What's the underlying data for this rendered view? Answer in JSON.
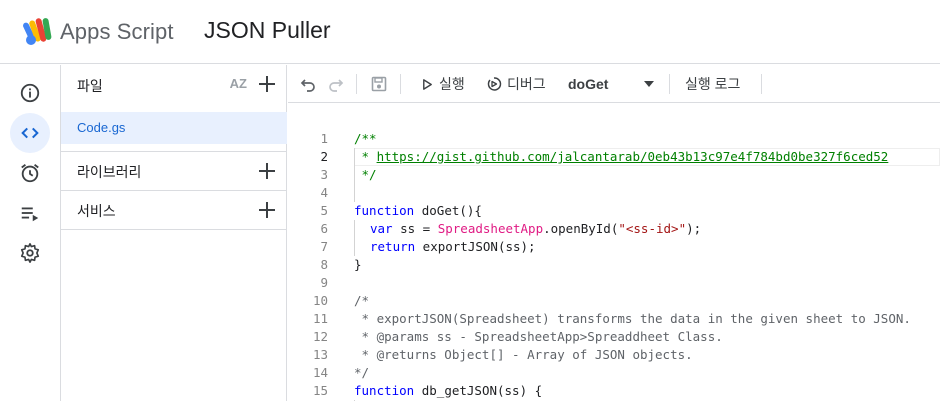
{
  "header": {
    "app_name": "Apps Script",
    "project_title": "JSON Puller"
  },
  "rail": {
    "items": [
      {
        "name": "overview",
        "icon": "info-icon"
      },
      {
        "name": "editor",
        "icon": "code-icon",
        "active": true
      },
      {
        "name": "triggers",
        "icon": "alarm-icon"
      },
      {
        "name": "executions",
        "icon": "executions-list-icon"
      },
      {
        "name": "settings",
        "icon": "gear-icon"
      }
    ]
  },
  "files_panel": {
    "files_label": "파일",
    "sort_label": "AZ",
    "files": [
      {
        "name": "Code.gs",
        "selected": true
      }
    ],
    "libraries_label": "라이브러리",
    "services_label": "서비스"
  },
  "toolbar": {
    "run_label": "실행",
    "debug_label": "디버그",
    "function_select": "doGet",
    "log_label": "실행 로그"
  },
  "editor": {
    "active_line": 2,
    "line_numbers": [
      "1",
      "2",
      "3",
      "4",
      "5",
      "6",
      "7",
      "8",
      "9",
      "10",
      "11",
      "12",
      "13",
      "14",
      "15"
    ],
    "lines": {
      "l1": "/**",
      "l2_prefix": " * ",
      "l2_link": "https://gist.github.com/jalcantarab/0eb43b13c97e4f784bd0be327f6ced52",
      "l3": " */",
      "l4": "",
      "l5_kw": "function",
      "l5_rest": " doGet(){",
      "l6_kw": "var",
      "l6_mid": " ss = ",
      "l6_cls": "SpreadsheetApp",
      "l6_mid2": ".openById(",
      "l6_str": "\"<ss-id>\"",
      "l6_end": ");",
      "l7_kw": "return",
      "l7_rest": " exportJSON(ss);",
      "l8": "}",
      "l9": "",
      "l10": "/*",
      "l11": " * exportJSON(Spreadsheet) transforms the data in the given sheet to JSON.",
      "l12": " * @params ss - SpreadsheetApp>Spreaddheet Class.",
      "l13": " * @returns Object[] - Array of JSON objects.",
      "l14": "*/",
      "l15_kw": "function",
      "l15_rest": " db_getJSON(ss) {"
    }
  }
}
